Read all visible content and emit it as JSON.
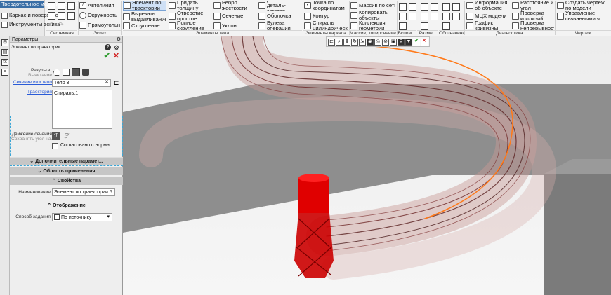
{
  "ribbon": {
    "tabs": [
      "Твердотельное моделирование",
      "Каркас и поверхности",
      "Инструменты эскиза"
    ],
    "system_group": "Системная",
    "sketch": {
      "items": [
        "Автолиния",
        "Окружность",
        "Прямоугольник"
      ],
      "group": "Эскиз"
    },
    "body": {
      "items": [
        "Элемент по траектории",
        "Вырезать выдавливанием",
        "Скругление",
        "Придать толщину",
        "Отверстие простое",
        "Полное скругление",
        "Ребро жесткости",
        "Сечение",
        "Уклон",
        "Добавить деталь-заготов...",
        "Оболочка",
        "Булева операция"
      ],
      "group": "Элементы тела"
    },
    "frame": {
      "items": [
        "Точка по координатам",
        "Контур",
        "Спираль цилиндрическ..."
      ],
      "group": "Элементы каркаса"
    },
    "copy": {
      "items": [
        "Массив по сетке",
        "Копировать объекты",
        "Коллекция геометрии"
      ],
      "group": "Массив, копирование"
    },
    "small_groups": [
      "Вспом...",
      "Разме...",
      "Обозначения"
    ],
    "diag": {
      "items": [
        "Информация об объекте",
        "МЦХ модели",
        "График кривизны",
        "Расстояние и угол",
        "Проверка коллизий",
        "Проверка непрерывности"
      ],
      "group": "Диагностика"
    },
    "drawing": {
      "items": [
        "Создать чертеж по модели",
        "Управление связанными ч..."
      ],
      "group": "Чертеж"
    }
  },
  "panel": {
    "title": "Параметры",
    "subtitle": "Элемент по траектории",
    "result_label": "Результат",
    "result_sub": "Вычитание",
    "section_label": "Сечение или тело",
    "section_value": "Тело 3",
    "trajectory_label": "Траектория",
    "trajectory_value": "Спираль:1",
    "motion_label": "Движение сечения",
    "motion_sub": "Сохранять угол на...",
    "agree_label": "Согласовано с норма...",
    "additional": "Дополнительные парамет...",
    "scope": "Область применения",
    "properties": "Свойства",
    "name_label": "Наименование",
    "name_value": "Элемент по траектории:5",
    "display": "Отображение",
    "method_label": "Способ задания",
    "method_value": "По источнику"
  },
  "colors": {
    "accent": "#3a6ea5",
    "ok": "#2e9b2e",
    "cancel": "#d21f1f",
    "solid": "#e00000",
    "helix": "#ff7a1a"
  }
}
